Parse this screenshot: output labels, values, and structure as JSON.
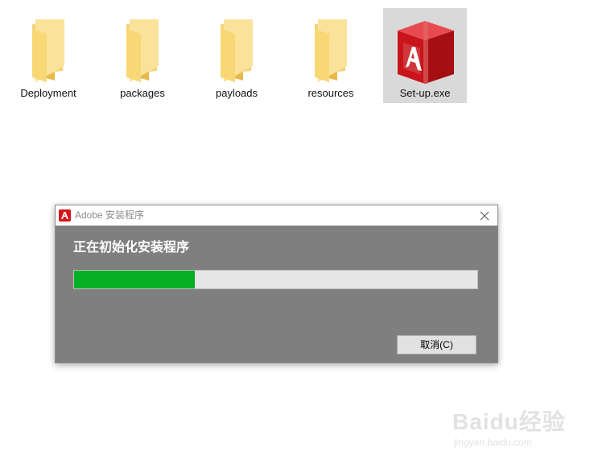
{
  "files": [
    {
      "name": "Deployment",
      "icon": "folder-icon"
    },
    {
      "name": "packages",
      "icon": "folder-icon"
    },
    {
      "name": "payloads",
      "icon": "folder-icon"
    },
    {
      "name": "resources",
      "icon": "folder-icon"
    },
    {
      "name": "Set-up.exe",
      "icon": "adobe-installer-icon"
    }
  ],
  "dialog": {
    "title": "Adobe 安装程序",
    "status": "正在初始化安装程序",
    "progress": 0.3,
    "cancel_label": "取消(C)"
  },
  "watermark": {
    "brand": "Baidu经验",
    "url": "jingyan.baidu.com"
  },
  "colors": {
    "folder": "#f8d775",
    "adobe_red": "#d4161c",
    "progress_green": "#06b025",
    "dialog_bg": "#7f7f7f"
  }
}
